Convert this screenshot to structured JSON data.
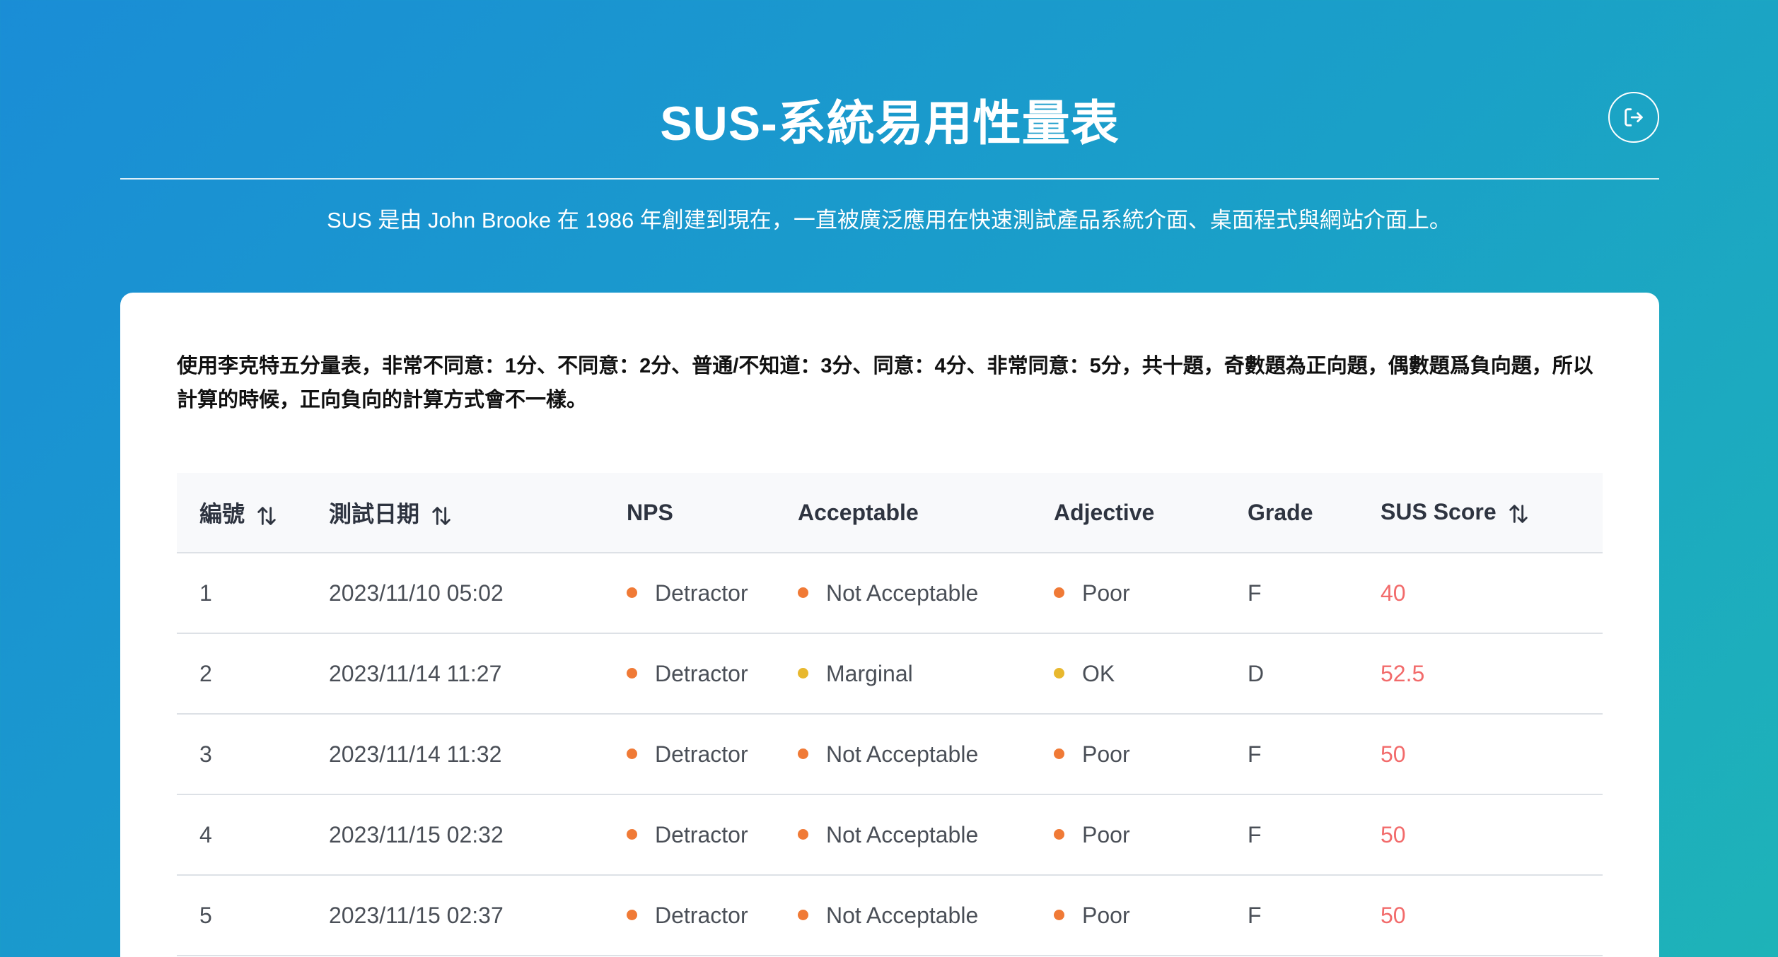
{
  "header": {
    "title": "SUS-系統易用性量表",
    "subtitle": "SUS 是由 John Brooke 在 1986 年創建到現在，一直被廣泛應用在快速測試產品系統介面、桌面程式與網站介面上。",
    "logout_icon": "logout-icon"
  },
  "card": {
    "description": "使用李克特五分量表，非常不同意：1分、不同意：2分、普通/不知道：3分、同意：4分、非常同意：5分，共十題，奇數題為正向題，偶數題爲負向題，所以計算的時候，正向負向的計算方式會不一樣。"
  },
  "table": {
    "columns": [
      {
        "label": "編號",
        "sortable": true
      },
      {
        "label": "測試日期",
        "sortable": true
      },
      {
        "label": "NPS",
        "sortable": false
      },
      {
        "label": "Acceptable",
        "sortable": false
      },
      {
        "label": "Adjective",
        "sortable": false
      },
      {
        "label": "Grade",
        "sortable": false
      },
      {
        "label": "SUS Score",
        "sortable": true
      }
    ],
    "rows": [
      {
        "id": "1",
        "date": "2023/11/10 05:02",
        "nps": "Detractor",
        "nps_color": "#f07a36",
        "acceptable": "Not Acceptable",
        "acceptable_color": "#f07a36",
        "adjective": "Poor",
        "adjective_color": "#f07a36",
        "grade": "F",
        "score": "40"
      },
      {
        "id": "2",
        "date": "2023/11/14 11:27",
        "nps": "Detractor",
        "nps_color": "#f07a36",
        "acceptable": "Marginal",
        "acceptable_color": "#e8b82e",
        "adjective": "OK",
        "adjective_color": "#e8b82e",
        "grade": "D",
        "score": "52.5"
      },
      {
        "id": "3",
        "date": "2023/11/14 11:32",
        "nps": "Detractor",
        "nps_color": "#f07a36",
        "acceptable": "Not Acceptable",
        "acceptable_color": "#f07a36",
        "adjective": "Poor",
        "adjective_color": "#f07a36",
        "grade": "F",
        "score": "50"
      },
      {
        "id": "4",
        "date": "2023/11/15 02:32",
        "nps": "Detractor",
        "nps_color": "#f07a36",
        "acceptable": "Not Acceptable",
        "acceptable_color": "#f07a36",
        "adjective": "Poor",
        "adjective_color": "#f07a36",
        "grade": "F",
        "score": "50"
      },
      {
        "id": "5",
        "date": "2023/11/15 02:37",
        "nps": "Detractor",
        "nps_color": "#f07a36",
        "acceptable": "Not Acceptable",
        "acceptable_color": "#f07a36",
        "adjective": "Poor",
        "adjective_color": "#f07a36",
        "grade": "F",
        "score": "50"
      }
    ]
  },
  "colors": {
    "score": "#f26b6b",
    "detractor": "#f07a36",
    "marginal": "#e8b82e"
  }
}
